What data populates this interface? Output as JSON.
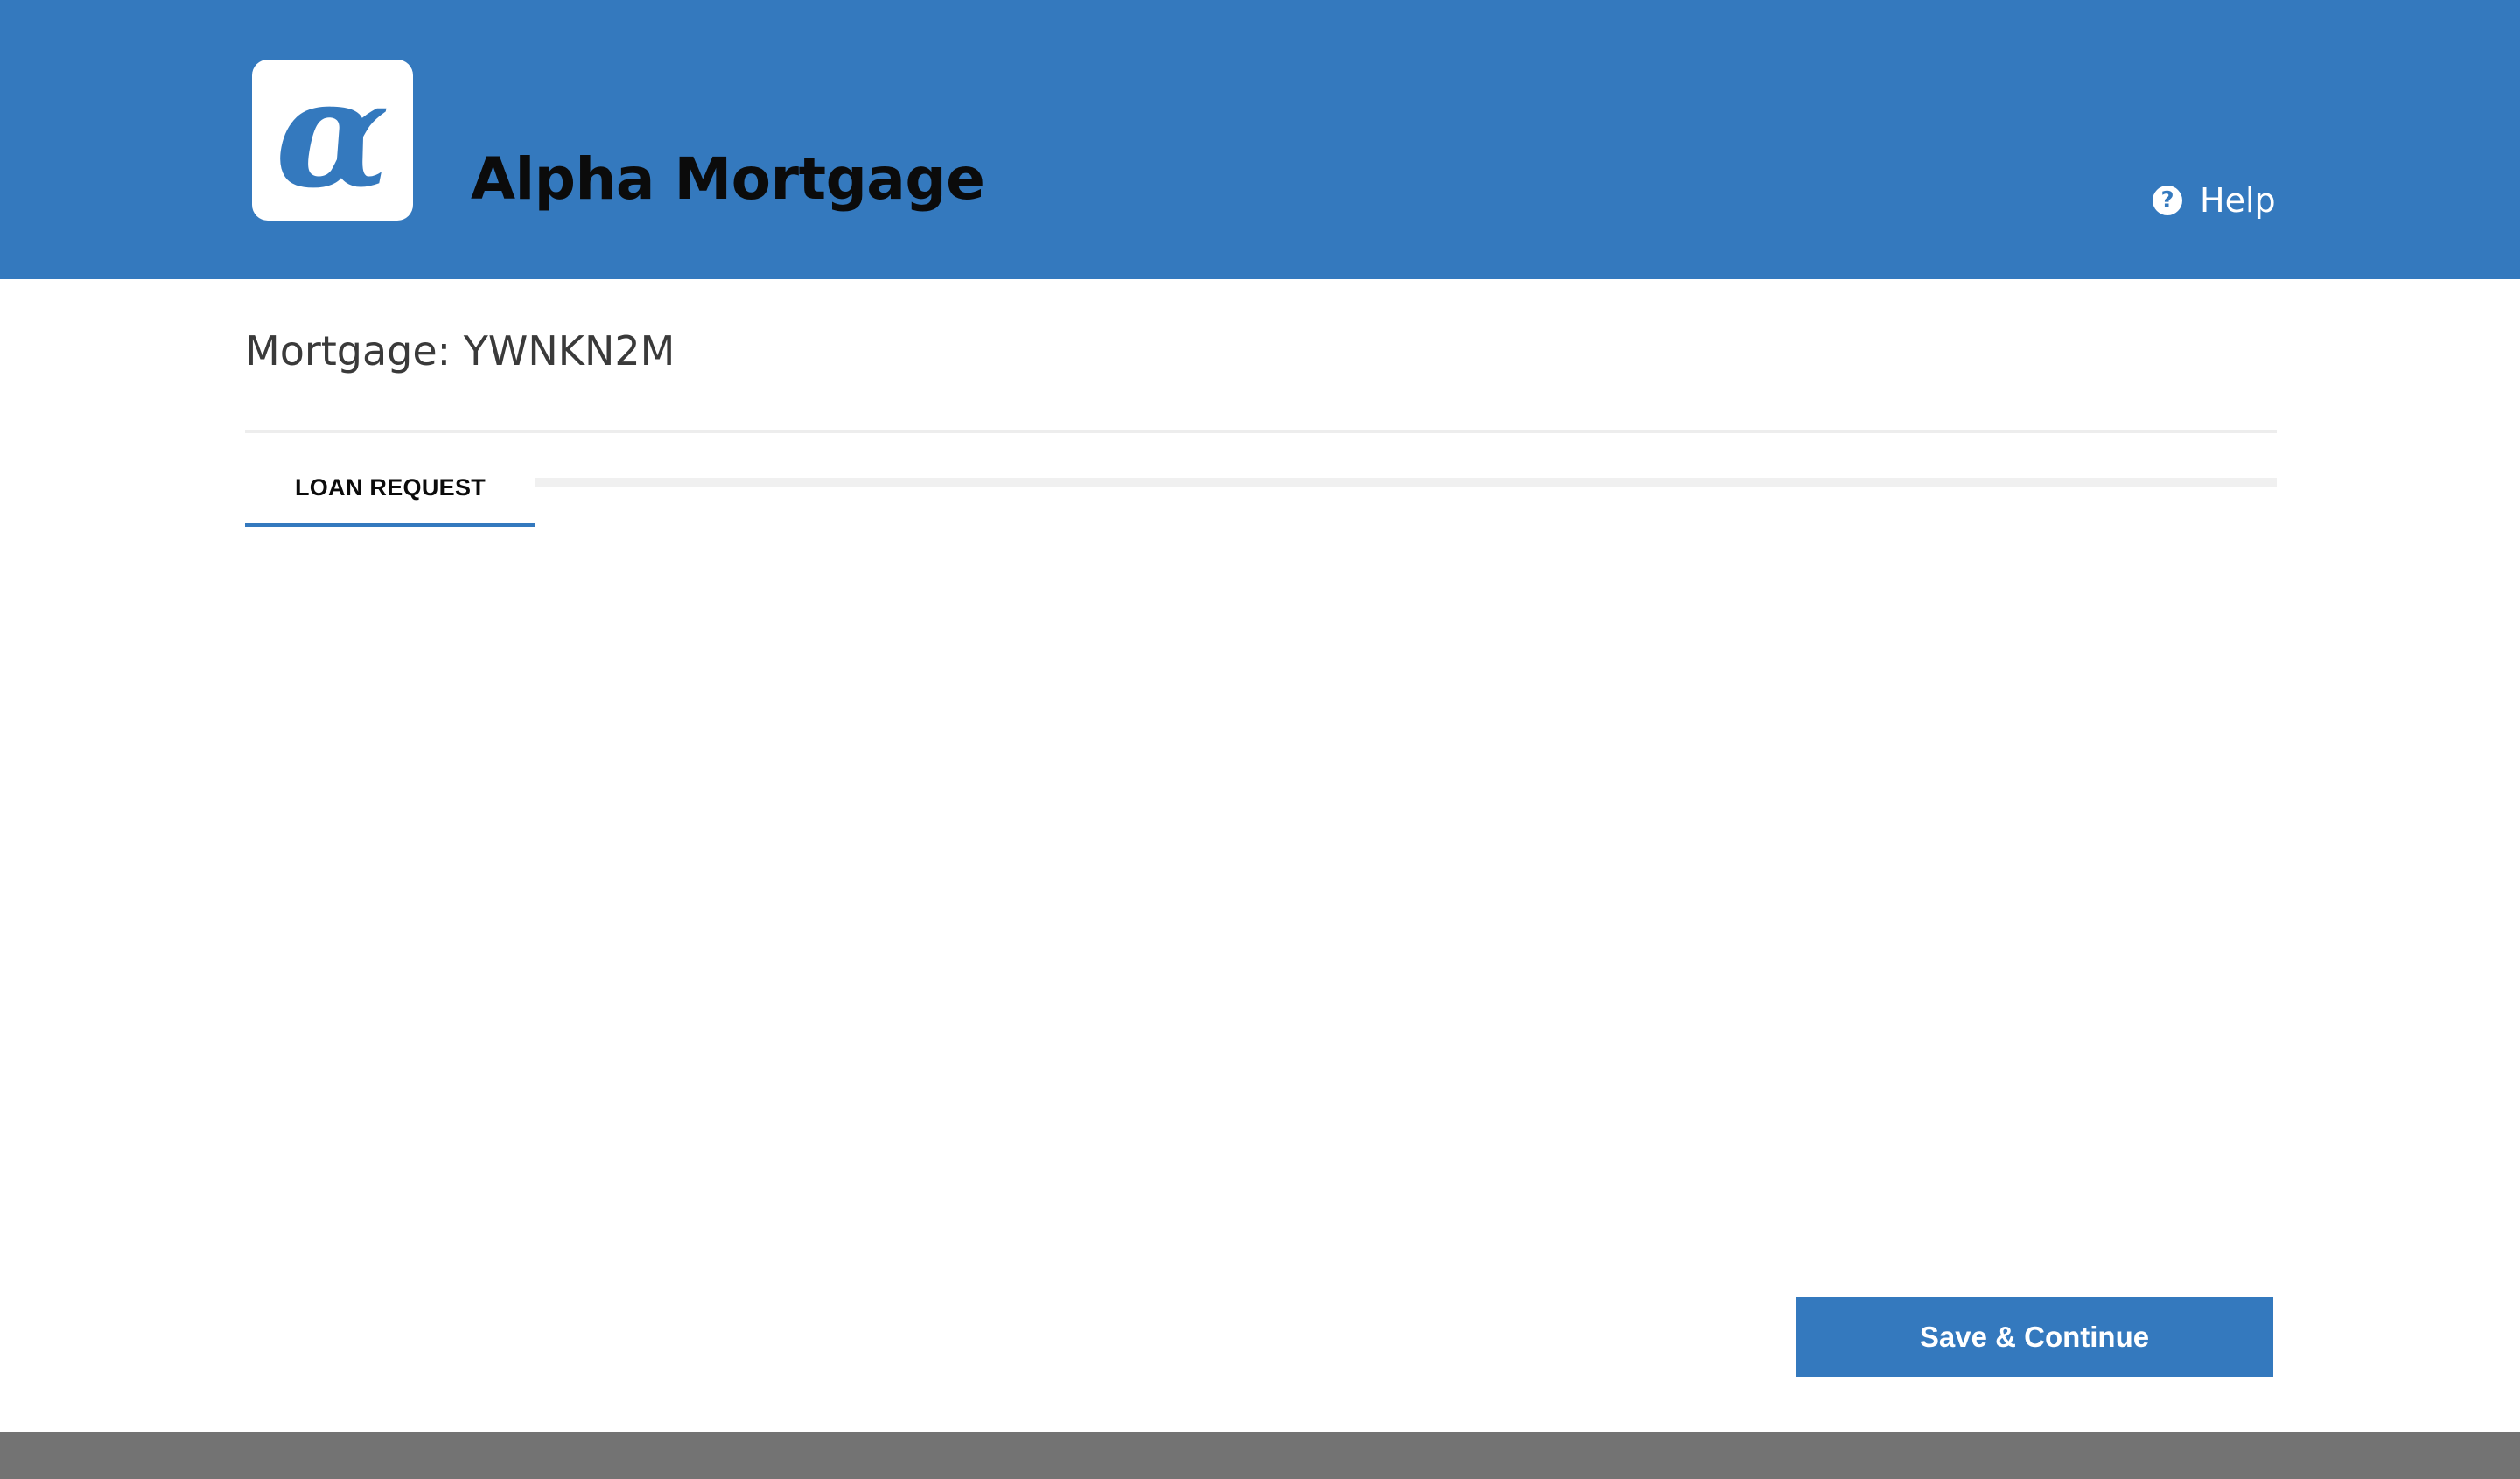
{
  "header": {
    "logo_icon": "alpha-logo-icon",
    "logo_glyph": "α",
    "app_title": "Alpha Mortgage",
    "help_label": "Help",
    "help_icon": "question-circle-icon",
    "background_color": "#3479be"
  },
  "main": {
    "mortgage_title": "Mortgage: YWNKN2M",
    "tabs": [
      {
        "label": "LOAN REQUEST",
        "active": true
      }
    ],
    "save_button_label": "Save & Continue"
  },
  "colors": {
    "accent": "#3479be",
    "footer": "#737373"
  }
}
